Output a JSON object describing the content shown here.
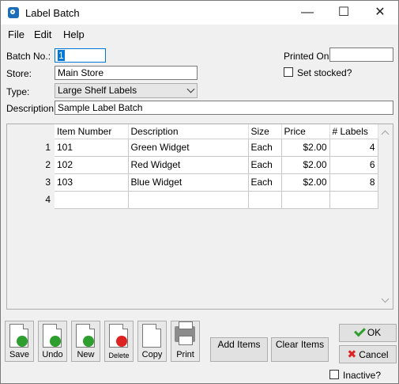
{
  "window": {
    "title": "Label Batch",
    "minimize": "—",
    "maximize": "☐",
    "close": "✕"
  },
  "menu": [
    "File",
    "Edit",
    "Help"
  ],
  "header": {
    "batch_no_label": "Batch No.:",
    "batch_no": "1",
    "store_label": "Store:",
    "store": "Main Store",
    "type_label": "Type:",
    "type": "Large Shelf Labels",
    "description_label": "Description:",
    "description": "Sample Label Batch",
    "printed_on_label": "Printed On:",
    "printed_on": "",
    "set_stocked_label": "Set stocked?"
  },
  "grid": {
    "columns": [
      "Item Number",
      "Description",
      "Size",
      "Price",
      "# Labels"
    ],
    "rows": [
      {
        "n": "1",
        "item": "101",
        "desc": "Green Widget",
        "size": "Each",
        "price": "$2.00",
        "labels": "4"
      },
      {
        "n": "2",
        "item": "102",
        "desc": "Red Widget",
        "size": "Each",
        "price": "$2.00",
        "labels": "6"
      },
      {
        "n": "3",
        "item": "103",
        "desc": "Blue Widget",
        "size": "Each",
        "price": "$2.00",
        "labels": "8"
      },
      {
        "n": "4",
        "item": "",
        "desc": "",
        "size": "",
        "price": "",
        "labels": ""
      }
    ]
  },
  "toolbar": {
    "save": "Save",
    "undo": "Undo",
    "new": "New",
    "delete": "Delete",
    "copy": "Copy",
    "print": "Print",
    "add_items": "Add Items",
    "clear_items": "Clear Items"
  },
  "dialog": {
    "ok": "OK",
    "cancel": "Cancel",
    "inactive": "Inactive?"
  },
  "colors": {
    "accent": "#0078d7",
    "ok_green": "#2e9e2e",
    "cancel_red": "#dd2222"
  }
}
